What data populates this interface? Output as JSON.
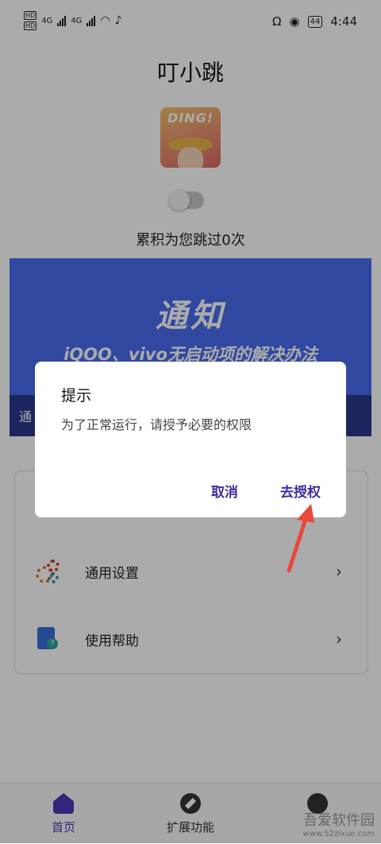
{
  "status_bar": {
    "network_1": "4G",
    "network_2": "4G",
    "hd_1": "HD",
    "hd_2": "HD",
    "battery": "44",
    "time": "4:44"
  },
  "app": {
    "title": "叮小跳",
    "logo_text": "DING!",
    "skip_count": "累积为您跳过0次"
  },
  "banner": {
    "title": "通知",
    "subtitle": "iQOO、vivo无启动项的解决办法",
    "strip_text": "通"
  },
  "menu": {
    "items": [
      {
        "label": "通用设置",
        "icon": "gear-icon"
      },
      {
        "label": "使用帮助",
        "icon": "help-book-icon"
      }
    ]
  },
  "tabbar": {
    "items": [
      {
        "label": "首页",
        "active": true
      },
      {
        "label": "扩展功能",
        "active": false
      }
    ]
  },
  "dialog": {
    "title": "提示",
    "message": "为了正常运行，请授予必要的权限",
    "cancel_label": "取消",
    "confirm_label": "去授权"
  },
  "watermark": {
    "text": "吾爱软件园",
    "url": "www.52zixue.com"
  },
  "colors": {
    "accent": "#3e2f9e",
    "banner": "#4a6cf0",
    "banner_strip": "#2b3a8c",
    "arrow": "#e8473b"
  }
}
